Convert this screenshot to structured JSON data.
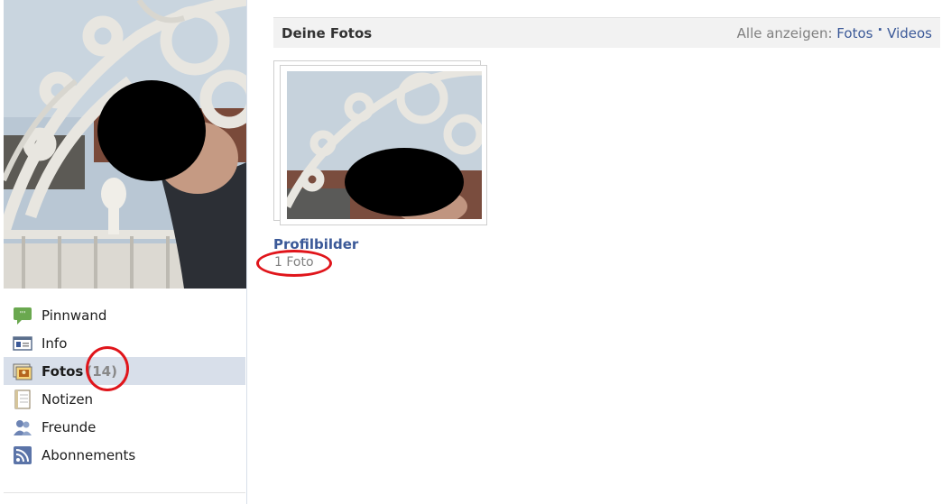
{
  "nav": {
    "items": [
      {
        "label": "Pinnwand",
        "icon": "wall-speech-bubble-icon"
      },
      {
        "label": "Info",
        "icon": "info-card-icon"
      },
      {
        "label": "Fotos",
        "count": "(14)",
        "icon": "photos-icon",
        "active": true
      },
      {
        "label": "Notizen",
        "icon": "notes-icon"
      },
      {
        "label": "Freunde",
        "icon": "friends-icon"
      },
      {
        "label": "Abonnements",
        "icon": "rss-feed-icon"
      }
    ]
  },
  "main": {
    "header": {
      "title": "Deine Fotos",
      "show_all_label": "Alle anzeigen:",
      "photos_link": "Fotos",
      "separator": "·",
      "videos_link": "Videos"
    },
    "album": {
      "title": "Profilbilder",
      "count": "1 Foto"
    }
  },
  "colors": {
    "link": "#3b5998",
    "active_nav_bg": "#d8dfea",
    "annotation_circle": "#e0151b",
    "header_bg": "#f2f2f2"
  }
}
